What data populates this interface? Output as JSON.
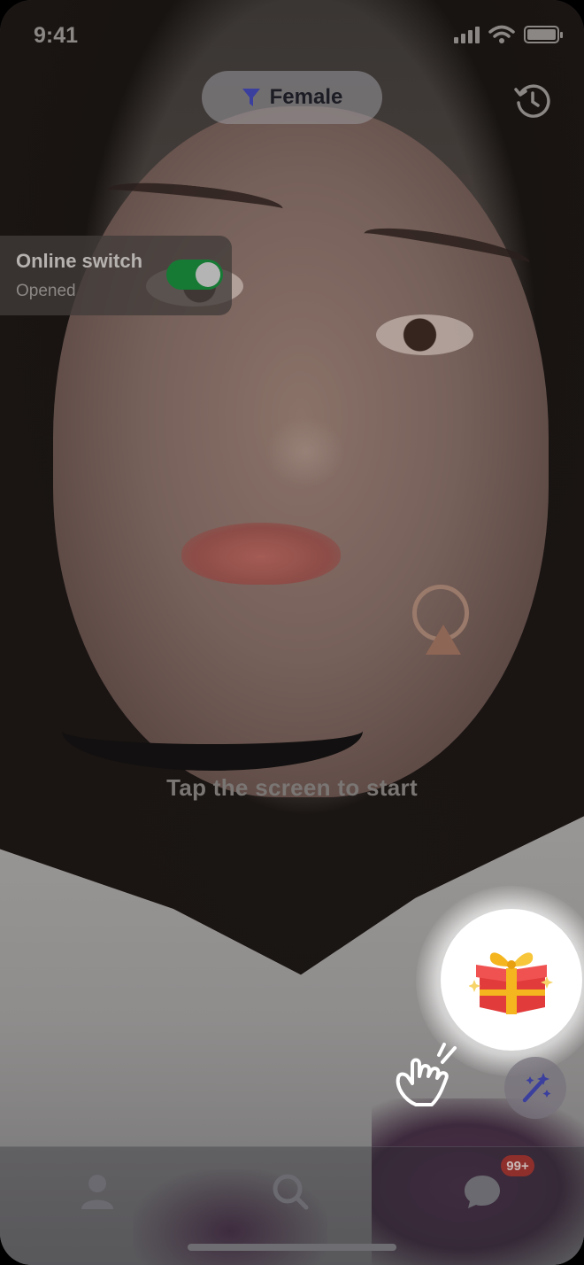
{
  "status_bar": {
    "time": "9:41"
  },
  "filter": {
    "label": "Female",
    "icon": "funnel-icon"
  },
  "history": {
    "icon": "history-clock-icon"
  },
  "online_switch": {
    "title": "Online switch",
    "status": "Opened",
    "enabled": true
  },
  "hint": {
    "text": "Tap the screen to start"
  },
  "gift": {
    "icon": "gift-box-icon"
  },
  "hand": {
    "icon": "tap-hand-icon"
  },
  "magic": {
    "icon": "magic-wand-icon"
  },
  "tab_bar": {
    "tabs": [
      {
        "name": "profile",
        "icon": "person-icon"
      },
      {
        "name": "search",
        "icon": "search-icon"
      },
      {
        "name": "messages",
        "icon": "chat-icon"
      }
    ],
    "messages_badge": "99+"
  },
  "colors": {
    "toggle_on": "#167a35",
    "filter_icon": "#3b3f9e",
    "gift_red": "#e23b3b",
    "gift_gold": "#f5b51e",
    "badge": "#8e2f2c"
  }
}
